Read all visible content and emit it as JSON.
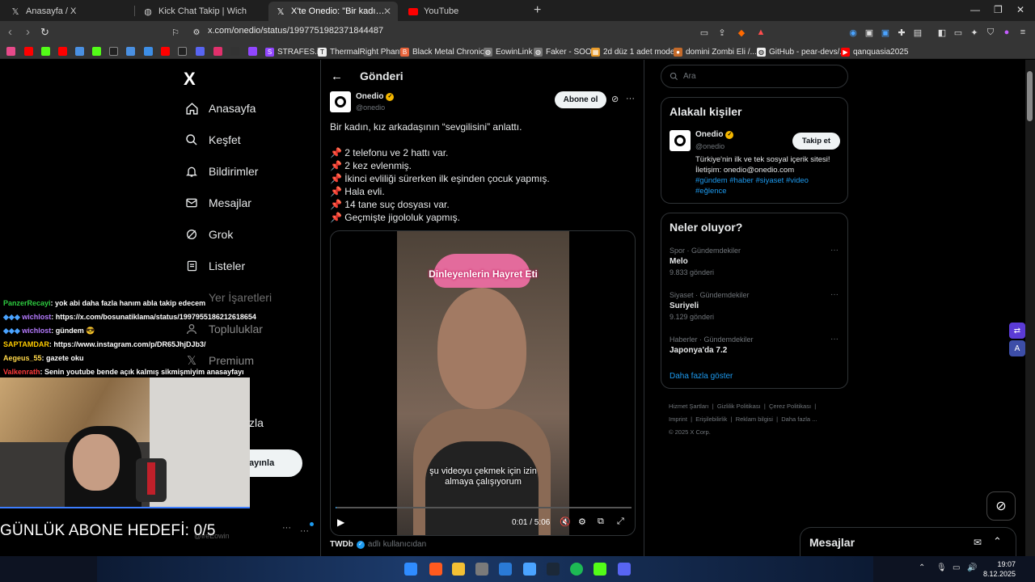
{
  "tabs": [
    {
      "title": "Anasayfa / X",
      "icon": "x-logo-icon"
    },
    {
      "title": "Kick Chat Takip | Wich",
      "icon": "globe-icon"
    },
    {
      "title": "X'te Onedio: \"Bir kadın, kız arkad",
      "icon": "x-logo-icon",
      "active": true
    },
    {
      "title": "YouTube",
      "icon": "youtube-icon"
    }
  ],
  "address": {
    "url": "x.com/onedio/status/1997751982371844487"
  },
  "bookmarks": [
    "STRAFES.io",
    "ThermalRight Phant...",
    "Black Metal Chronic...",
    "EowinLink",
    "Faker - SOOP",
    "2d düz 1 adet mode...",
    "domini Zombi Eli /...",
    "GitHub - pear-devs/...",
    "qanquasia2025"
  ],
  "sidebar": {
    "logo": "X",
    "items": [
      "Anasayfa",
      "Keşfet",
      "Bildirimler",
      "Mesajlar",
      "Grok",
      "Listeler",
      "Yer İşaretleri",
      "Topluluklar",
      "Premium"
    ],
    "partial_item": "zla",
    "post_button": "ayınla",
    "user_handle": "@ireEowin"
  },
  "post": {
    "header": "Gönderi",
    "author_name": "Onedio",
    "author_handle": "@onedio",
    "subscribe_label": "Abone ol",
    "text": "Bir kadın, kız arkadaşının “sevgilisini” anlattı.",
    "bullets": [
      "2 telefonu ve 2 hattı var.",
      "2 kez evlenmiş.",
      "İkinci evliliği sürerken ilk eşinden çocuk yapmış.",
      "Hala evli.",
      "14 tane suç dosyası var.",
      "Geçmişte jigololuk yapmış."
    ],
    "video_caption_top": "Dinleyenlerin Hayret Eti",
    "video_subtitle_1": "şu videoyu çekmek için izin",
    "video_subtitle_2": "almaya çalışıyorum",
    "video_time": "0:01 / 5:06",
    "video_progress": 0.003,
    "quoted_source": "TWDb",
    "quoted_suffix": "adlı kullanıcıdan"
  },
  "search": {
    "placeholder": "Ara"
  },
  "related": {
    "title": "Alakalı kişiler",
    "name": "Onedio",
    "handle": "@onedio",
    "follow_label": "Takip et",
    "bio": "Türkiye'nin ilk ve tek sosyal içerik sitesi! İletişim: onedio@onedio.com",
    "tags": "#gündem #haber #siyaset #video #eğlence"
  },
  "trends": {
    "title": "Neler oluyor?",
    "items": [
      {
        "category": "Spor · Gündemdekiler",
        "name": "Melo",
        "count": "9.833 gönderi"
      },
      {
        "category": "Siyaset · Gündemdekiler",
        "name": "Suriyeli",
        "count": "9.129 gönderi"
      },
      {
        "category": "Haberler · Gündemdekiler",
        "name": "Japonya'da 7.2",
        "count": ""
      }
    ],
    "show_more": "Daha fazla göster"
  },
  "footer": {
    "links": [
      "Hizmet Şartları",
      "Gizlilik Politikası",
      "Çerez Politikası",
      "Imprint",
      "Erişilebilirlik",
      "Reklam bilgisi",
      "Daha fazla ..."
    ],
    "copyright": "© 2025 X Corp."
  },
  "messages_drawer": {
    "title": "Mesajlar"
  },
  "chat": [
    {
      "user": "PanzerRecayi",
      "color": "#2ecc40",
      "msg": ": yok abi daha fazla hanım abla takip edecem"
    },
    {
      "user": "wichlost",
      "color": "#b57bff",
      "msg": ": https://x.com/bosunatiklama/status/1997955186212618654"
    },
    {
      "user": "wichlost",
      "color": "#b57bff",
      "msg": ": gündem 😎"
    },
    {
      "user": "SAPTAMDAR",
      "color": "#ffcc00",
      "msg": ": https://www.instagram.com/p/DR65JhjDJb3/"
    },
    {
      "user": "Aegeus_55",
      "color": "#ffd84a",
      "msg": ": gazete oku"
    },
    {
      "user": "Valkenrath",
      "color": "#ff3b3b",
      "msg": ": Senin youtube bende açık kalmış sikmişmiyim anasayfayı"
    }
  ],
  "stream_goal": "GÜNLÜK ABONE HEDEFİ: 0/5",
  "clock": {
    "time": "19:07",
    "date": "8.12.2025"
  },
  "colors": {
    "accent": "#1d9bf0",
    "verified": "#f5b700",
    "background": "#000000"
  }
}
